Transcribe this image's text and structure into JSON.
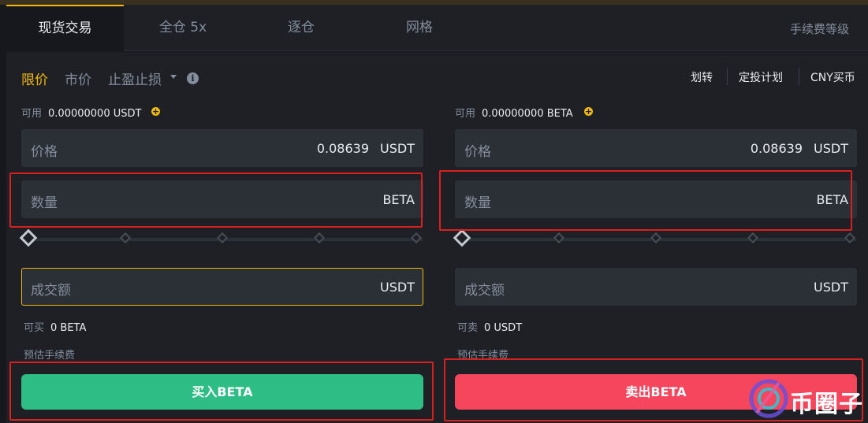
{
  "tabs": [
    {
      "label": "现货交易",
      "active": true
    },
    {
      "label": "全仓 5x"
    },
    {
      "label": "逐仓"
    },
    {
      "label": "网格"
    }
  ],
  "fee_level": "手续费等级",
  "order_types": {
    "limit": "限价",
    "market": "市价",
    "stop": "止盈止损"
  },
  "links": {
    "transfer": "划转",
    "recurring": "定投计划",
    "buy_cny": "CNY买币"
  },
  "buy": {
    "available_label": "可用",
    "available_value": "0.00000000 USDT",
    "price_label": "价格",
    "price_value": "0.08639",
    "price_unit": "USDT",
    "amount_label": "数量",
    "amount_unit": "BETA",
    "total_label": "成交额",
    "total_unit": "USDT",
    "max_label": "可买",
    "max_value": "0 BETA",
    "fee_label": "预估手续费",
    "button_label": "买入BETA",
    "slider_percent": 0
  },
  "sell": {
    "available_label": "可用",
    "available_value": "0.00000000 BETA",
    "price_label": "价格",
    "price_value": "0.08639",
    "price_unit": "USDT",
    "amount_label": "数量",
    "amount_unit": "BETA",
    "total_label": "成交额",
    "total_unit": "USDT",
    "max_label": "可卖",
    "max_value": "0 USDT",
    "fee_label": "预估手续费",
    "button_label": "卖出BETA",
    "slider_percent": 0
  },
  "watermark": "币圈子",
  "colors": {
    "accent": "#f0b90b",
    "buy": "#2ebd85",
    "sell": "#f6465d",
    "highlight_box": "#d9201f"
  }
}
